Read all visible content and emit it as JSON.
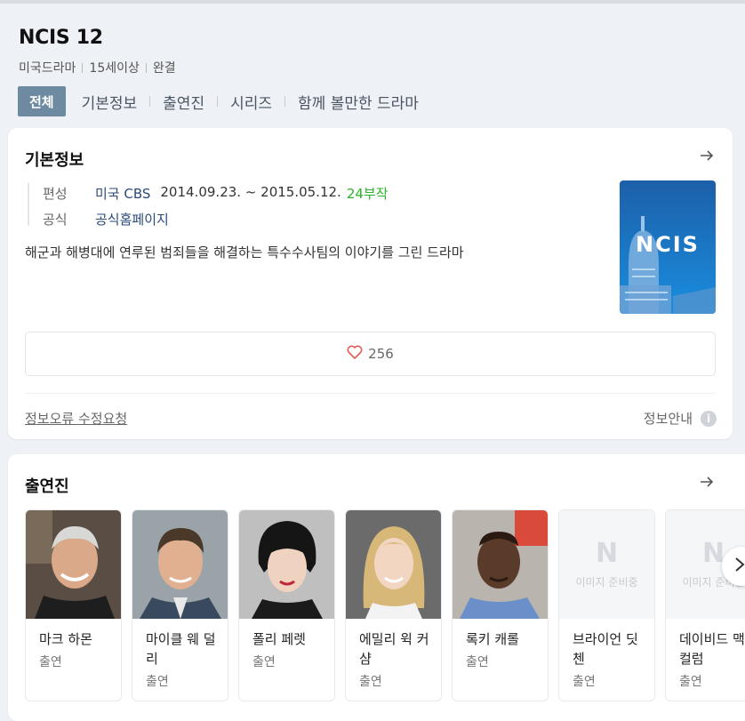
{
  "header": {
    "title": "NCIS 12",
    "meta": [
      "미국드라마",
      "15세이상",
      "완결"
    ],
    "tabs": [
      {
        "label": "전체",
        "active": true
      },
      {
        "label": "기본정보",
        "active": false
      },
      {
        "label": "출연진",
        "active": false
      },
      {
        "label": "시리즈",
        "active": false
      },
      {
        "label": "함께 볼만한 드라마",
        "active": false
      }
    ]
  },
  "basic_info": {
    "title": "기본정보",
    "arrow_icon": "arrow-right-icon",
    "rows": {
      "broadcast_label": "편성",
      "broadcast_channel": "미국 CBS",
      "broadcast_period": "2014.09.23. ~ 2015.05.12.",
      "episodes": "24부작",
      "official_label": "공식",
      "official_value": "공식홈페이지"
    },
    "description": "해군과 해병대에 연루된 범죄들을 해결하는 특수수사팀의 이야기를 그린 드라마",
    "poster_text": "NCIS",
    "like_count": "256",
    "report_link": "정보오류 수정요청",
    "info_guide": "정보안내",
    "info_icon_glyph": "i"
  },
  "cast": {
    "title": "출연진",
    "items": [
      {
        "name": "마크 하몬",
        "role": "출연"
      },
      {
        "name": "마이클 웨 덜리",
        "role": "출연"
      },
      {
        "name": "폴리 페렛",
        "role": "출연"
      },
      {
        "name": "에밀리 윅 커샴",
        "role": "출연"
      },
      {
        "name": "록키 캐롤",
        "role": "출연"
      },
      {
        "name": "브라이언 딧첸",
        "role": "출연"
      },
      {
        "name": "데이비드 맥컬럼",
        "role": "출연"
      }
    ],
    "placeholder_letter": "N",
    "placeholder_text": "이미지 준비중"
  },
  "colors": {
    "active_tab": "#6e8aa1",
    "link": "#2a4a7a",
    "episodes": "#2bb32b",
    "heart": "#e25858",
    "background": "#eef1f5"
  }
}
